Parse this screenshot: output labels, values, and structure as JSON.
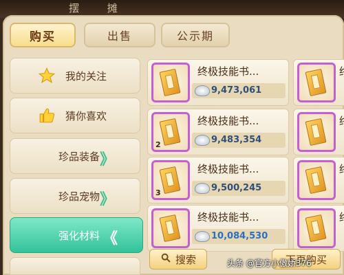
{
  "window": {
    "title": "摆 摊"
  },
  "tabs": [
    {
      "label": "购买",
      "active": true
    },
    {
      "label": "出售",
      "active": false
    },
    {
      "label": "公示期",
      "active": false
    }
  ],
  "sidebar": {
    "items": [
      {
        "label": "我的关注",
        "icon": "star-icon"
      },
      {
        "label": "猜你喜欢",
        "icon": "thumbs-up-icon"
      },
      {
        "label": "珍品装备",
        "icon": "chevron-right-icon"
      },
      {
        "label": "珍品宠物",
        "icon": "chevron-right-icon"
      },
      {
        "label": "强化材料",
        "icon": "chevron-left-icon",
        "active": true
      }
    ]
  },
  "listings": [
    {
      "name": "终极技能书...",
      "price": "9,473,061",
      "qty": ""
    },
    {
      "name": "终极技能书...",
      "price": "9,483,354",
      "qty": "2"
    },
    {
      "name": "终极技能书...",
      "price": "9,500,245",
      "qty": "3"
    },
    {
      "name": "终极技能书...",
      "price": "10,084,530",
      "qty": ""
    }
  ],
  "right_column_partial_char": "终",
  "footer": {
    "search_label": "搜索",
    "next_label": "下页购买",
    "watermark": "头条 @官方小傲娇376"
  },
  "colors": {
    "active_tab": "#f8dd8e",
    "active_sidebar": "#33c29a",
    "item_border": "#c35fd0",
    "price_blue": "#2a6fc2"
  }
}
